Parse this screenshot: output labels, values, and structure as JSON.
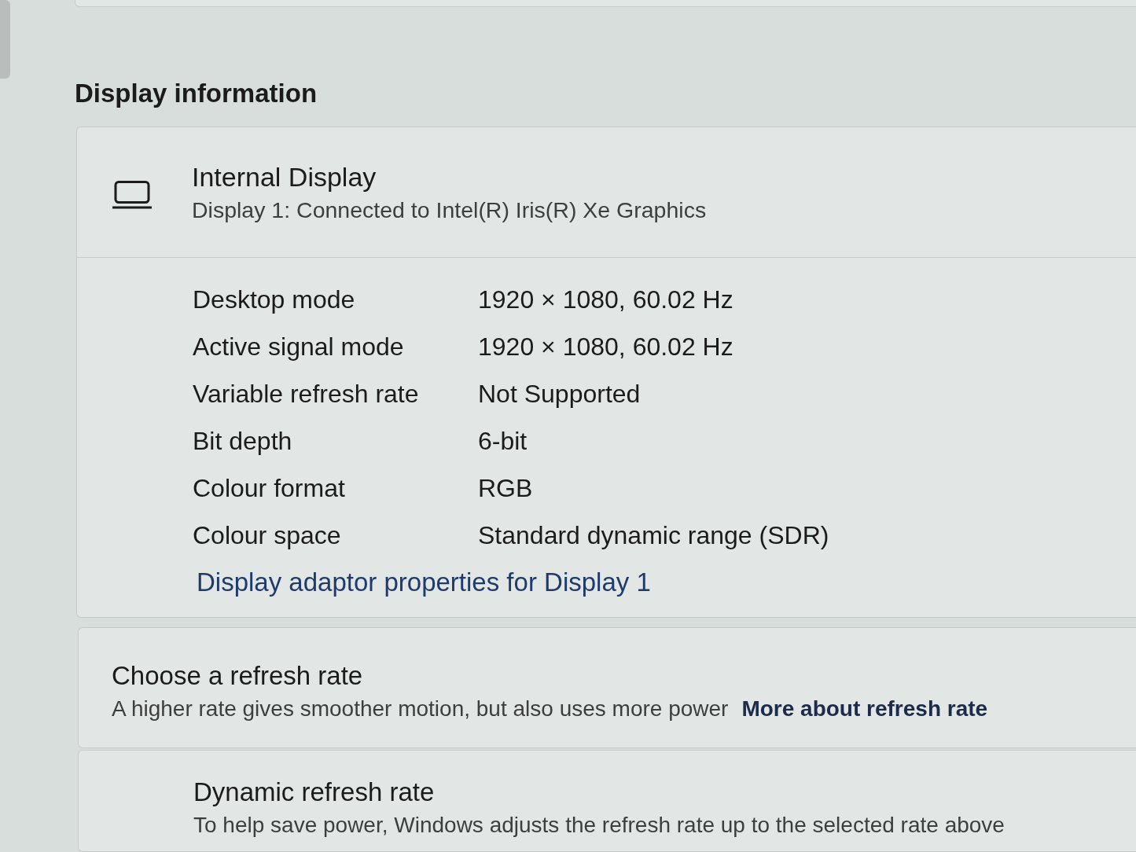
{
  "section_title": "Display information",
  "display_card": {
    "title": "Internal Display",
    "subtitle": "Display 1: Connected to Intel(R) Iris(R) Xe Graphics",
    "properties": [
      {
        "label": "Desktop mode",
        "value": "1920 × 1080, 60.02 Hz"
      },
      {
        "label": "Active signal mode",
        "value": "1920 × 1080, 60.02 Hz"
      },
      {
        "label": "Variable refresh rate",
        "value": "Not Supported"
      },
      {
        "label": "Bit depth",
        "value": "6-bit"
      },
      {
        "label": "Colour format",
        "value": "RGB"
      },
      {
        "label": "Colour space",
        "value": "Standard dynamic range (SDR)"
      }
    ],
    "link": "Display adaptor properties for Display 1"
  },
  "settings": [
    {
      "kind": "setting",
      "title": "Choose a refresh rate",
      "description": "A higher rate gives smoother motion, but also uses more power",
      "link": "More about refresh rate"
    },
    {
      "kind": "sub-option",
      "title": "Dynamic refresh rate",
      "description": "To help save power, Windows adjusts the refresh rate up to the selected rate above"
    }
  ]
}
